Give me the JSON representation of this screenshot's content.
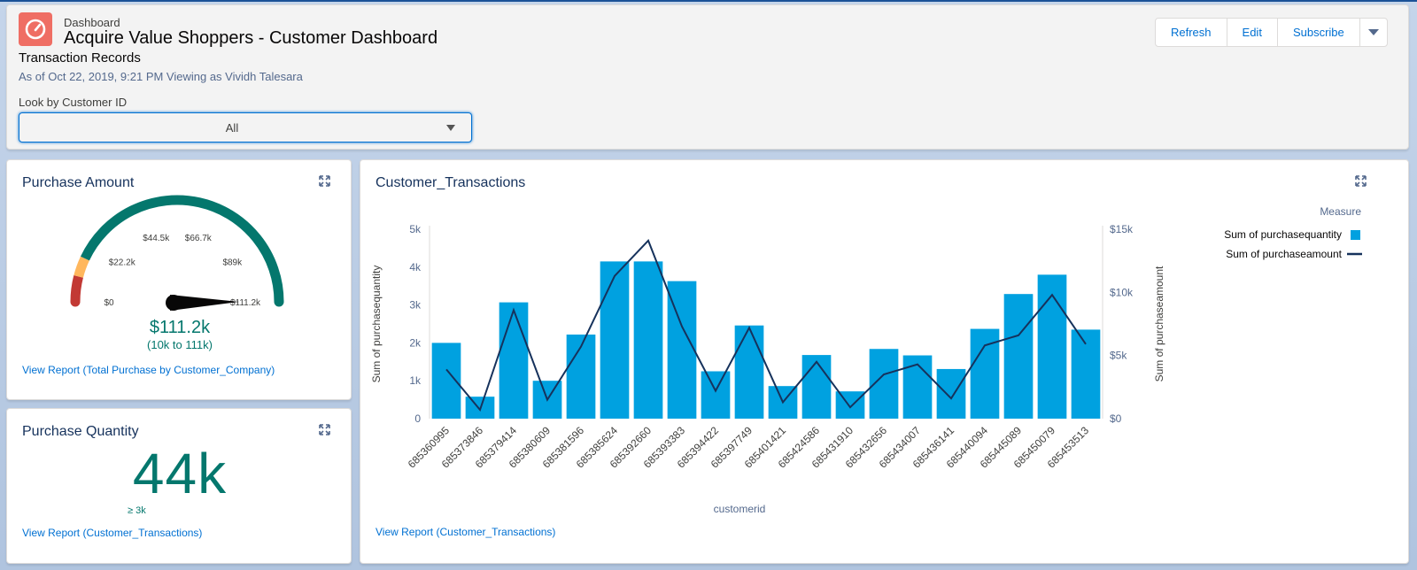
{
  "header": {
    "object_type": "Dashboard",
    "title": "Acquire Value Shoppers - Customer Dashboard",
    "subtitle": "Transaction Records",
    "as_of": "As of Oct 22, 2019, 9:21 PM Viewing as Vividh Talesara",
    "app_icon": "dashboard-gauge-icon",
    "buttons": {
      "refresh": "Refresh",
      "edit": "Edit",
      "subscribe": "Subscribe"
    }
  },
  "filter": {
    "label": "Look by Customer ID",
    "value": "All"
  },
  "purchase_amount": {
    "title": "Purchase Amount",
    "value_label": "$111.2k",
    "range_label": "(10k to 111k)",
    "gauge_ticks": [
      "$0",
      "$22.2k",
      "$44.5k",
      "$66.7k",
      "$89k",
      "$111.2k"
    ],
    "gauge_value": 1.0,
    "gauge_band_fractions": [
      0.08,
      0.14
    ],
    "view_report": "View Report (Total Purchase by Customer_Company)"
  },
  "purchase_quantity": {
    "title": "Purchase Quantity",
    "value_label": "44k",
    "sub_label": "≥ 3k",
    "view_report": "View Report (Customer_Transactions)"
  },
  "transactions": {
    "title": "Customer_Transactions",
    "view_report": "View Report (Customer_Transactions)"
  },
  "chart_data": {
    "type": "bar",
    "title": "Customer_Transactions",
    "xlabel": "customerid",
    "ylabel": "Sum of purchasequantity",
    "y2label": "Sum of purchaseamount",
    "legend_title": "Measure",
    "legend_position": "top-right",
    "categories": [
      "685360995",
      "685373846",
      "685379414",
      "685380609",
      "685381596",
      "685385624",
      "685392660",
      "685393383",
      "685394422",
      "685397749",
      "685401421",
      "685424586",
      "685431910",
      "685432656",
      "685434007",
      "685436141",
      "685440094",
      "685445089",
      "685450079",
      "685453513"
    ],
    "series": [
      {
        "name": "Sum of purchasequantity",
        "kind": "bar",
        "axis": "left",
        "color": "#00a1e0",
        "values": [
          2000,
          580,
          3070,
          1000,
          2220,
          4150,
          4150,
          3630,
          1250,
          2460,
          860,
          1680,
          720,
          1840,
          1670,
          1310,
          2370,
          3290,
          3800,
          2350
        ]
      },
      {
        "name": "Sum of purchaseamount",
        "kind": "line",
        "axis": "right",
        "color": "#16325c",
        "values": [
          3900,
          700,
          8600,
          1500,
          5700,
          11300,
          14100,
          7300,
          2200,
          7200,
          1300,
          4500,
          900,
          3500,
          4300,
          1600,
          5800,
          6600,
          9800,
          5900
        ]
      }
    ],
    "ylim": [
      0,
      5000
    ],
    "y_ticks": [
      {
        "v": 0,
        "label": "0"
      },
      {
        "v": 1000,
        "label": "1k"
      },
      {
        "v": 2000,
        "label": "2k"
      },
      {
        "v": 3000,
        "label": "3k"
      },
      {
        "v": 4000,
        "label": "4k"
      },
      {
        "v": 5000,
        "label": "5k"
      }
    ],
    "y2lim": [
      0,
      15000
    ],
    "y2_ticks": [
      {
        "v": 0,
        "label": "$0"
      },
      {
        "v": 5000,
        "label": "$5k"
      },
      {
        "v": 10000,
        "label": "$10k"
      },
      {
        "v": 15000,
        "label": "$15k"
      }
    ],
    "grid": false
  }
}
